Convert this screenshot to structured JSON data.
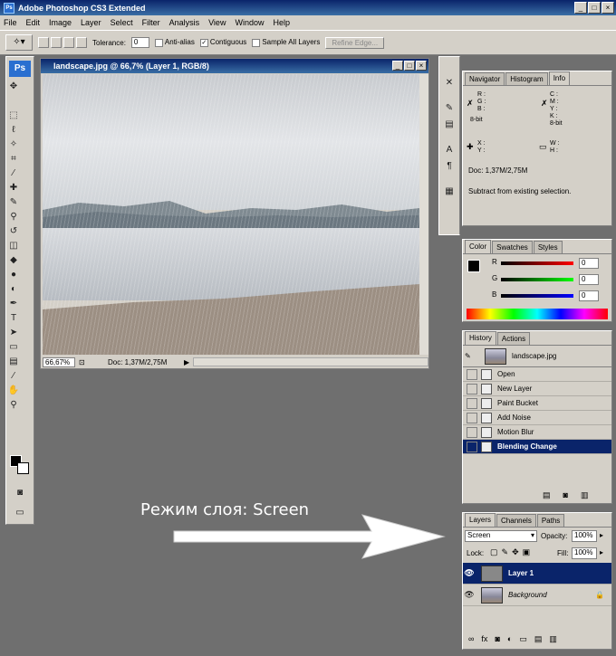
{
  "app": {
    "title": "Adobe Photoshop CS3 Extended"
  },
  "menu": [
    "File",
    "Edit",
    "Image",
    "Layer",
    "Select",
    "Filter",
    "Analysis",
    "View",
    "Window",
    "Help"
  ],
  "options": {
    "tolerance_label": "Tolerance:",
    "tolerance_value": "0",
    "antialias": "Anti-alias",
    "contiguous": "Contiguous",
    "sample_all": "Sample All Layers",
    "refine": "Refine Edge..."
  },
  "document": {
    "title": "landscape.jpg @ 66,7% (Layer 1, RGB/8)",
    "zoom": "66,67%",
    "doc_size": "Doc: 1,37M/2,75M"
  },
  "info_panel": {
    "tabs": [
      "Navigator",
      "Histogram",
      "Info"
    ],
    "left_labels": [
      "R :",
      "G :",
      "B :"
    ],
    "right_labels": [
      "C :",
      "M :",
      "Y :",
      "K :"
    ],
    "bit_left": "8-bit",
    "bit_right": "8-bit",
    "xy": [
      "X :",
      "Y :"
    ],
    "wh": [
      "W :",
      "H :"
    ],
    "doc": "Doc: 1,37M/2,75M",
    "hint": "Subtract from existing selection."
  },
  "color_panel": {
    "tabs": [
      "Color",
      "Swatches",
      "Styles"
    ],
    "channels": [
      {
        "label": "R",
        "value": "0"
      },
      {
        "label": "G",
        "value": "0"
      },
      {
        "label": "B",
        "value": "0"
      }
    ]
  },
  "history_panel": {
    "tabs": [
      "History",
      "Actions"
    ],
    "snapshot": "landscape.jpg",
    "items": [
      "Open",
      "New Layer",
      "Paint Bucket",
      "Add Noise",
      "Motion Blur",
      "Blending Change"
    ]
  },
  "layers_panel": {
    "tabs": [
      "Layers",
      "Channels",
      "Paths"
    ],
    "blend_mode": "Screen",
    "opacity_label": "Opacity:",
    "opacity": "100%",
    "lock_label": "Lock:",
    "fill_label": "Fill:",
    "fill": "100%",
    "layers": [
      {
        "name": "Layer 1"
      },
      {
        "name": "Background"
      }
    ]
  },
  "annotation": "Режим слоя: Screen",
  "colors": {
    "title_bar": "#0a246a",
    "panel_bg": "#d4d0c8",
    "workspace": "#6f6f6f",
    "selection": "#0a246a"
  }
}
